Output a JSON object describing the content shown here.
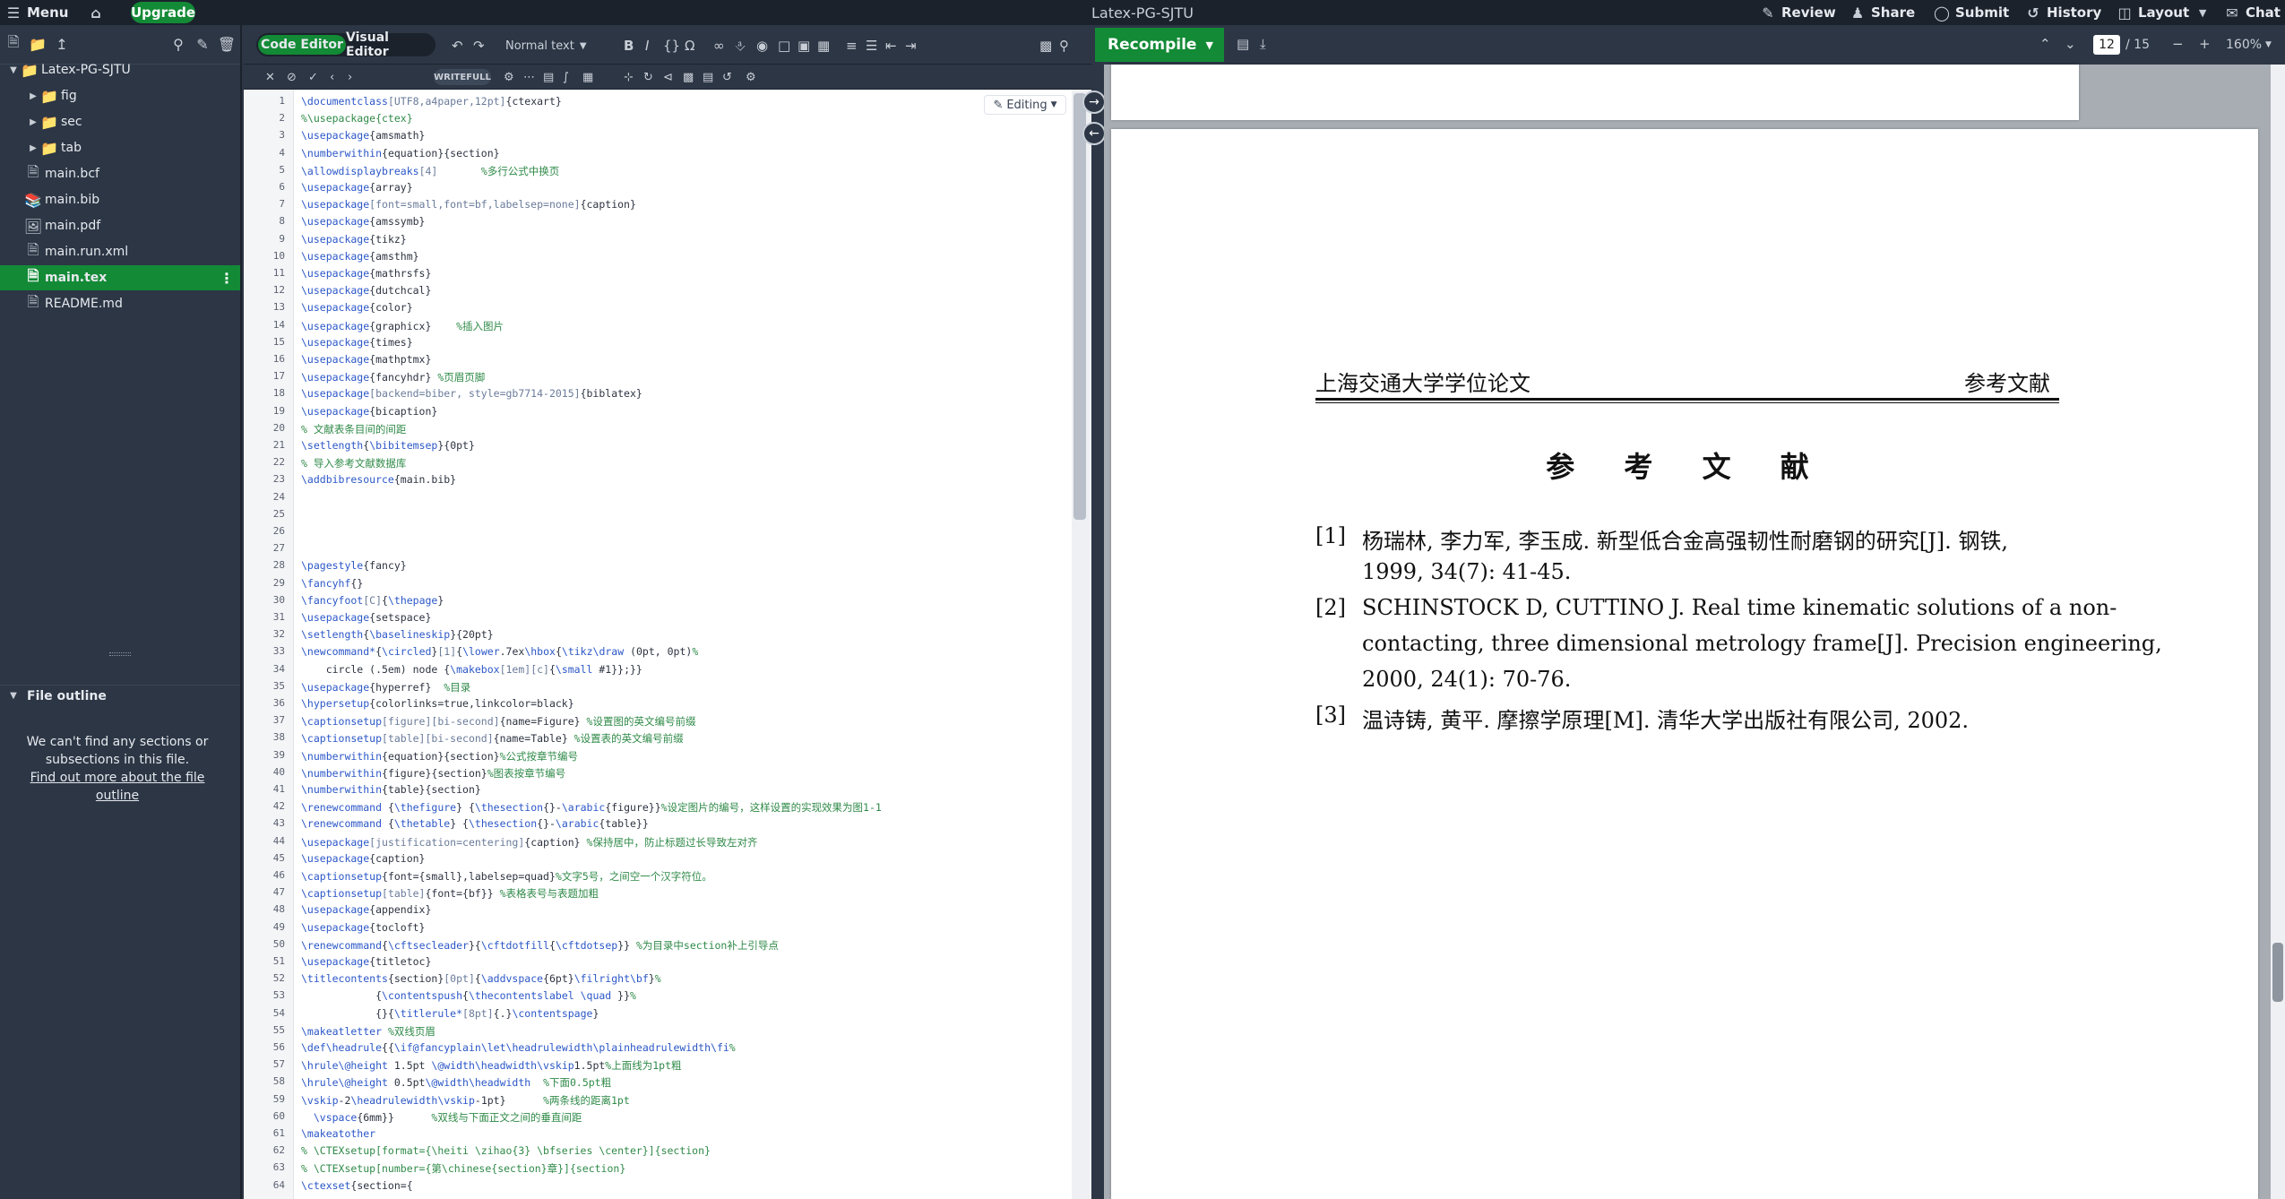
{
  "topbar": {
    "menu_label": "Menu",
    "upgrade_label": "Upgrade",
    "project_title": "Latex-PG-SJTU",
    "review_label": "Review",
    "share_label": "Share",
    "submit_label": "Submit",
    "history_label": "History",
    "layout_label": "Layout",
    "chat_label": "Chat"
  },
  "sidebar": {
    "root_folder": "Latex-PG-SJTU",
    "items": [
      {
        "label": "fig",
        "type": "folder"
      },
      {
        "label": "sec",
        "type": "folder"
      },
      {
        "label": "tab",
        "type": "folder"
      },
      {
        "label": "main.bcf",
        "type": "file"
      },
      {
        "label": "main.bib",
        "type": "file"
      },
      {
        "label": "main.pdf",
        "type": "file"
      },
      {
        "label": "main.run.xml",
        "type": "file"
      },
      {
        "label": "main.tex",
        "type": "file",
        "selected": true
      },
      {
        "label": "README.md",
        "type": "file"
      }
    ],
    "outline_title": "File outline",
    "outline_message": "We can't find any sections or subsections in this file.",
    "outline_link": "Find out more about the file outline"
  },
  "editor_toolbar": {
    "code_editor_label": "Code Editor",
    "visual_editor_label": "Visual Editor",
    "style_select": "Normal text",
    "writefull_label": "WRITEFULL",
    "editing_label": "Editing"
  },
  "code_lines": [
    "\\documentclass[UTF8,a4paper,12pt]{ctexart}",
    "%\\usepackage{ctex}",
    "\\usepackage{amsmath}",
    "\\numberwithin{equation}{section}",
    "\\allowdisplaybreaks[4]       %多行公式中换页",
    "\\usepackage{array}",
    "\\usepackage[font=small,font=bf,labelsep=none]{caption}",
    "\\usepackage{amssymb}",
    "\\usepackage{tikz}",
    "\\usepackage{amsthm}",
    "\\usepackage{mathrsfs}",
    "\\usepackage{dutchcal}",
    "\\usepackage{color}",
    "\\usepackage{graphicx}    %插入图片",
    "\\usepackage{times}",
    "\\usepackage{mathptmx}",
    "\\usepackage{fancyhdr} %页眉页脚",
    "\\usepackage[backend=biber, style=gb7714-2015]{biblatex}",
    "\\usepackage{bicaption}",
    "% 文献表条目间的间距",
    "\\setlength{\\bibitemsep}{0pt}",
    "% 导入参考文献数据库",
    "\\addbibresource{main.bib}",
    "",
    "",
    "",
    "",
    "\\pagestyle{fancy}",
    "\\fancyhf{}",
    "\\fancyfoot[C]{\\thepage}",
    "\\usepackage{setspace}",
    "\\setlength{\\baselineskip}{20pt}",
    "\\newcommand*{\\circled}[1]{\\lower.7ex\\hbox{\\tikz\\draw (0pt, 0pt)%",
    "    circle (.5em) node {\\makebox[1em][c]{\\small #1}};}}",
    "\\usepackage{hyperref}  %目录",
    "\\hypersetup{colorlinks=true,linkcolor=black}",
    "\\captionsetup[figure][bi-second]{name=Figure} %设置图的英文编号前缀",
    "\\captionsetup[table][bi-second]{name=Table} %设置表的英文编号前缀",
    "\\numberwithin{equation}{section}%公式按章节编号",
    "\\numberwithin{figure}{section}%图表按章节编号",
    "\\numberwithin{table}{section}",
    "\\renewcommand {\\thefigure} {\\thesection{}-\\arabic{figure}}%设定图片的编号，这样设置的实现效果为图1-1",
    "\\renewcommand {\\thetable} {\\thesection{}-\\arabic{table}}",
    "\\usepackage[justification=centering]{caption} %保持居中，防止标题过长导致左对齐",
    "\\usepackage{caption}",
    "\\captionsetup{font={small},labelsep=quad}%文字5号，之间空一个汉字符位。",
    "\\captionsetup[table]{font={bf}} %表格表号与表题加粗",
    "\\usepackage{appendix}",
    "\\usepackage{tocloft}",
    "\\renewcommand{\\cftsecleader}{\\cftdotfill{\\cftdotsep}} %为目录中section补上引导点",
    "\\usepackage{titletoc}",
    "\\titlecontents{section}[0pt]{\\addvspace{6pt}\\filright\\bf}%",
    "            {\\contentspush{\\thecontentslabel \\quad }}%",
    "            {}{\\titlerule*[8pt]{.}\\contentspage}",
    "\\makeatletter %双线页眉",
    "\\def\\headrule{{\\if@fancyplain\\let\\headrulewidth\\plainheadrulewidth\\fi%",
    "\\hrule\\@height 1.5pt \\@width\\headwidth\\vskip1.5pt%上面线为1pt粗",
    "\\hrule\\@height 0.5pt\\@width\\headwidth  %下面0.5pt粗",
    "\\vskip-2\\headrulewidth\\vskip-1pt}      %两条线的距离1pt",
    "  \\vspace{6mm}}      %双线与下面正文之间的垂直间距",
    "\\makeatother",
    "% \\CTEXsetup[format={\\heiti \\zihao{3} \\bfseries \\center}]{section}",
    "% \\CTEXsetup[number={第\\chinese{section}章}]{section}",
    "\\ctexset{section={"
  ],
  "pdf_toolbar": {
    "recompile_label": "Recompile",
    "page_current": "12",
    "page_total": "/ 15",
    "zoom": "160%"
  },
  "pdf": {
    "header_left": "上海交通大学学位论文",
    "header_right": "参考文献",
    "title": "参 考 文 献",
    "refs": [
      {
        "num": "[1]",
        "lines": [
          "杨瑞林, 李力军, 李玉成. 新型低合金高强韧性耐磨钢的研究[J]. 钢铁,",
          "1999, 34(7): 41-45."
        ]
      },
      {
        "num": "[2]",
        "lines": [
          "SCHINSTOCK D, CUTTINO J. Real time kinematic solutions of a non-",
          "contacting, three dimensional metrology frame[J]. Precision engineering,",
          "2000, 24(1): 70-76."
        ]
      },
      {
        "num": "[3]",
        "lines": [
          "温诗铸, 黄平. 摩擦学原理[M]. 清华大学出版社有限公司, 2002."
        ]
      }
    ]
  }
}
